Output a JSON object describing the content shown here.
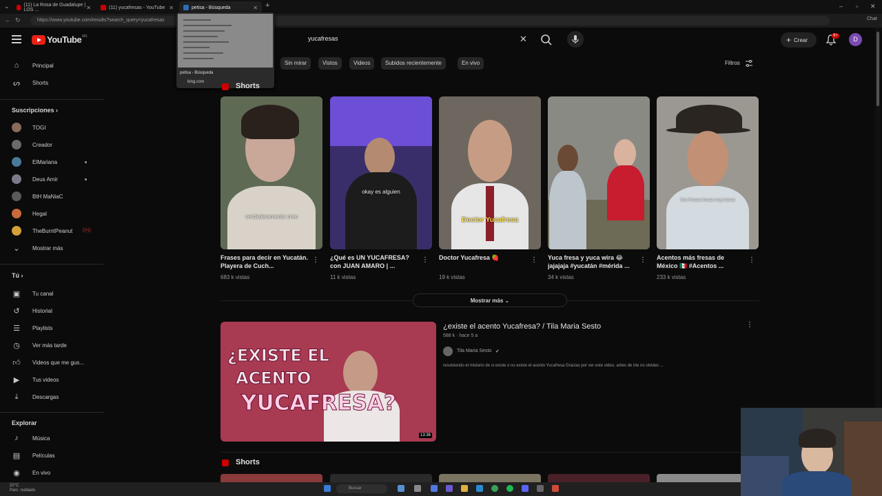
{
  "browser": {
    "tabs": [
      {
        "label": "(11) La Rosa de Guadalupe | LOS ...",
        "active": false
      },
      {
        "label": "(11) yucafresas - YouTube",
        "active": false
      },
      {
        "label": "petisa - Búsqueda",
        "active": true
      }
    ],
    "url": "https://www.youtube.com/results?search_query=yucafresas",
    "preview": {
      "title": "petisa - Búsqueda",
      "domain": "bing.com"
    },
    "chat_label": "Chat"
  },
  "header": {
    "logo_text": "YouTube",
    "country": "MX",
    "search_value": "yucafresas",
    "create_label": "Crear",
    "notif_badge": "9+",
    "avatar_letter": "D"
  },
  "chips": [
    "Sin mirar",
    "Vistos",
    "Videos",
    "Subidos recientemente",
    "En vivo"
  ],
  "filters_label": "Filtros",
  "sidebar": {
    "main": [
      {
        "label": "Principal",
        "icon": "home-icon"
      },
      {
        "label": "Shorts",
        "icon": "shorts-icon"
      }
    ],
    "subs_heading": "Suscripciones",
    "subs": [
      {
        "label": "TOGI",
        "color": "#8a6a5a"
      },
      {
        "label": "Creador",
        "color": "#6a6a6a"
      },
      {
        "label": "ElMariana",
        "color": "#4a7a9a"
      },
      {
        "label": "Deus Amir",
        "color": "#7a7a8a"
      },
      {
        "label": "BtH MaNiaC",
        "color": "#5a5a5a"
      },
      {
        "label": "Hegal",
        "color": "#c96a3a"
      },
      {
        "label": "TheBurntPeanut",
        "color": "#d4a03a"
      }
    ],
    "subs_more": "Mostrar más",
    "you_heading": "Tú",
    "you": [
      {
        "label": "Tu canal",
        "icon": "channel-icon"
      },
      {
        "label": "Historial",
        "icon": "history-icon"
      },
      {
        "label": "Playlists",
        "icon": "playlists-icon"
      },
      {
        "label": "Ver más tarde",
        "icon": "watch-later-icon"
      },
      {
        "label": "Videos que me gus...",
        "icon": "liked-icon"
      },
      {
        "label": "Tus videos",
        "icon": "your-videos-icon"
      },
      {
        "label": "Descargas",
        "icon": "downloads-icon"
      }
    ],
    "explore_heading": "Explorar",
    "explore": [
      {
        "label": "Música",
        "icon": "music-icon"
      },
      {
        "label": "Películas",
        "icon": "movies-icon"
      },
      {
        "label": "En vivo",
        "icon": "live-icon"
      }
    ]
  },
  "shorts_heading": "Shorts",
  "shorts": [
    {
      "title": "Frases para decir en Yucatán. Playera de Cuch...",
      "views": "683 k vistas",
      "caption": "verdaderamente creo",
      "bg": "#5f6a55"
    },
    {
      "title": "¿Qué es UN YUCAFRESA? con JUAN AMARO | ...",
      "views": "11 k vistas",
      "caption": "okay es alguien",
      "bg": "#3a2e6a"
    },
    {
      "title": "Doctor Yucafresa 🍓",
      "views": "19 k vistas",
      "caption": "Doctor Yucafresa",
      "bg": "#6e675f"
    },
    {
      "title": "Yuca fresa y yuca wira 😂 jajajaja #yucatán #mérida ...",
      "views": "34 k vistas",
      "caption": "",
      "bg": "#8a8a84"
    },
    {
      "title": "Acentos más fresas de México 🇲🇽 #Acentos ...",
      "views": "233 k vistas",
      "caption": "Son Frases fresas muy fresas",
      "bg": "#9a9890"
    }
  ],
  "show_more": "Mostrar más",
  "video": {
    "title": "¿existe el acento Yucafresa? / Tila Maria Sesto",
    "meta": "588 k · hace 5 a",
    "channel": "Tila Maria Sesto",
    "description": "resolviendo el misterio de si existe o no existe el acento Yucafresa Gracias por ver este video, antes de irte no olvides ...",
    "duration": "13:36",
    "thumb_line1": "¿EXISTE EL",
    "thumb_line2": "ACENTO",
    "thumb_line3": "YUCAFRESA?"
  },
  "shorts2_heading": "Shorts",
  "taskbar": {
    "weather": "22°C",
    "weather_sub": "Parc. nublado",
    "search_label": "Buscar"
  }
}
